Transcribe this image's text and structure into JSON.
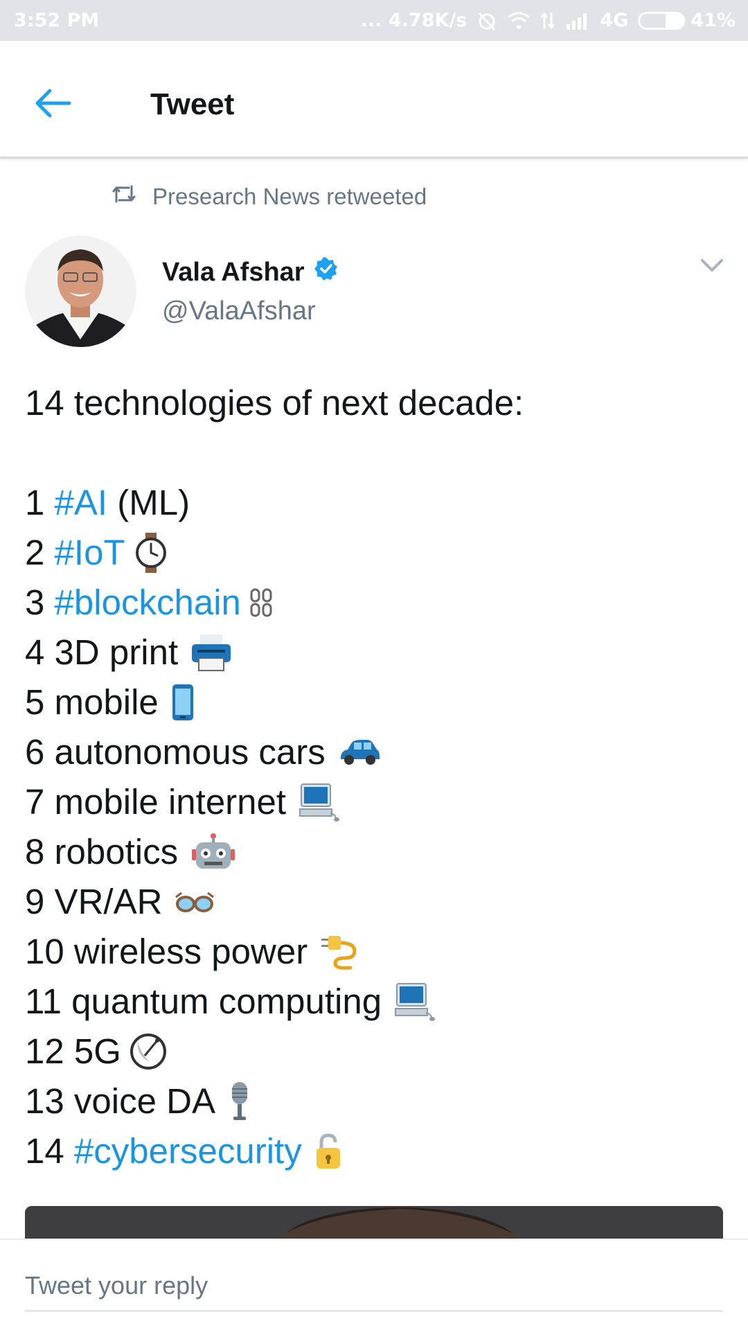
{
  "status_bar": {
    "time": "3:52 PM",
    "speed": "... 4.78K/s",
    "network": "4G",
    "battery_text": "41%",
    "battery_level": 0.41
  },
  "app_bar": {
    "back_icon": "arrow-left-icon",
    "title": "Tweet"
  },
  "retweet": {
    "icon": "retweet-icon",
    "text": "Presearch News retweeted"
  },
  "author": {
    "name": "Vala Afshar",
    "handle": "@ValaAfshar",
    "verified_icon": "verified-badge-icon"
  },
  "tweet": {
    "intro": "14 technologies of next decade:",
    "items": [
      {
        "num": "1",
        "tag": "#AI",
        "text": " (ML)",
        "emoji": ""
      },
      {
        "num": "2",
        "tag": "#IoT",
        "text": "",
        "emoji": "watch-icon"
      },
      {
        "num": "3",
        "tag": "#blockchain",
        "text": "",
        "emoji": "chain-icon"
      },
      {
        "num": "4",
        "tag": "",
        "text": "3D print",
        "emoji": "printer-icon"
      },
      {
        "num": "5",
        "tag": "",
        "text": "mobile",
        "emoji": "mobile-phone-icon"
      },
      {
        "num": "6",
        "tag": "",
        "text": "autonomous cars",
        "emoji": "car-icon"
      },
      {
        "num": "7",
        "tag": "",
        "text": "mobile internet",
        "emoji": "computer-icon"
      },
      {
        "num": "8",
        "tag": "",
        "text": "robotics",
        "emoji": "robot-icon"
      },
      {
        "num": "9",
        "tag": "",
        "text": "VR/AR",
        "emoji": "glasses-icon"
      },
      {
        "num": "10",
        "tag": "",
        "text": "wireless power",
        "emoji": "plug-icon"
      },
      {
        "num": "11",
        "tag": "",
        "text": "quantum computing",
        "emoji": "computer-icon"
      },
      {
        "num": "12",
        "tag": "",
        "text": "5G",
        "emoji": "satellite-dish-icon"
      },
      {
        "num": "13",
        "tag": "",
        "text": "voice DA",
        "emoji": "microphone-icon"
      },
      {
        "num": "14",
        "tag": "#cybersecurity",
        "text": "",
        "emoji": "lock-icon"
      }
    ]
  },
  "reply": {
    "placeholder": "Tweet your reply"
  },
  "colors": {
    "link": "#1b95e0",
    "secondary_text": "#657786",
    "status_bar_bg": "#e1e3e8"
  }
}
